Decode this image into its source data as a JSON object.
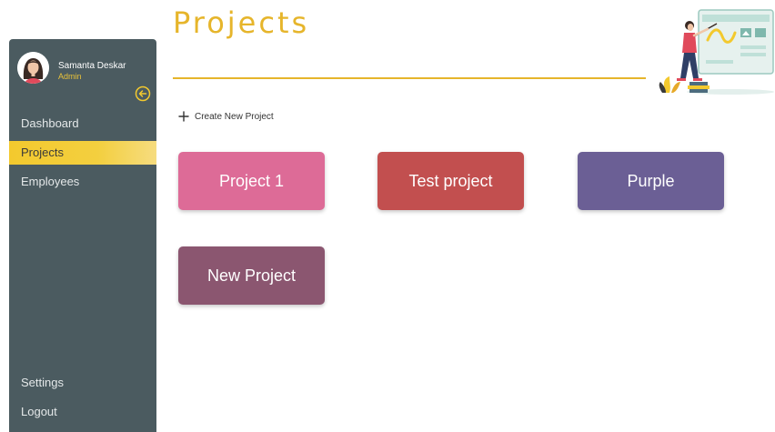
{
  "page": {
    "title": "Projects"
  },
  "user": {
    "name": "Samanta Deskar",
    "role": "Admin"
  },
  "icons": {
    "collapse": "circle-arrow-left-icon",
    "create": "plus-icon",
    "avatar": "user-avatar",
    "illustration": "dashboard-presenter-illustration"
  },
  "sidebar": {
    "items": [
      {
        "label": "Dashboard",
        "active": false
      },
      {
        "label": "Projects",
        "active": true
      },
      {
        "label": "Employees",
        "active": false
      }
    ],
    "bottom_items": [
      {
        "label": "Settings"
      },
      {
        "label": "Logout"
      }
    ]
  },
  "actions": {
    "create_label": "Create New Project"
  },
  "projects": [
    {
      "name": "Project 1",
      "color": "#dd6b97"
    },
    {
      "name": "Test project",
      "color": "#c24f4f"
    },
    {
      "name": "Purple",
      "color": "#6b5f95"
    },
    {
      "name": "New Project",
      "color": "#8b5670"
    }
  ],
  "colors": {
    "sidebar": "#4b5b60",
    "accent": "#e6b52b"
  }
}
